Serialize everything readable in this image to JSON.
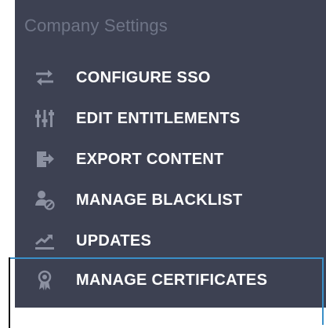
{
  "panel": {
    "header": "Company Settings",
    "items": [
      {
        "label": "CONFIGURE SSO",
        "icon": "arrows-swap-icon"
      },
      {
        "label": "EDIT ENTITLEMENTS",
        "icon": "sliders-icon"
      },
      {
        "label": "EXPORT CONTENT",
        "icon": "export-icon"
      },
      {
        "label": "MANAGE BLACKLIST",
        "icon": "user-block-icon"
      },
      {
        "label": "UPDATES",
        "icon": "trend-chart-icon"
      },
      {
        "label": "MANAGE CERTIFICATES",
        "icon": "certificate-icon"
      }
    ]
  },
  "colors": {
    "panel_background": "#3d4152",
    "header_text": "#6f7587",
    "item_text": "#ffffff",
    "icon_color": "#8c91a1",
    "selection_outline": "#3a8fc8"
  }
}
